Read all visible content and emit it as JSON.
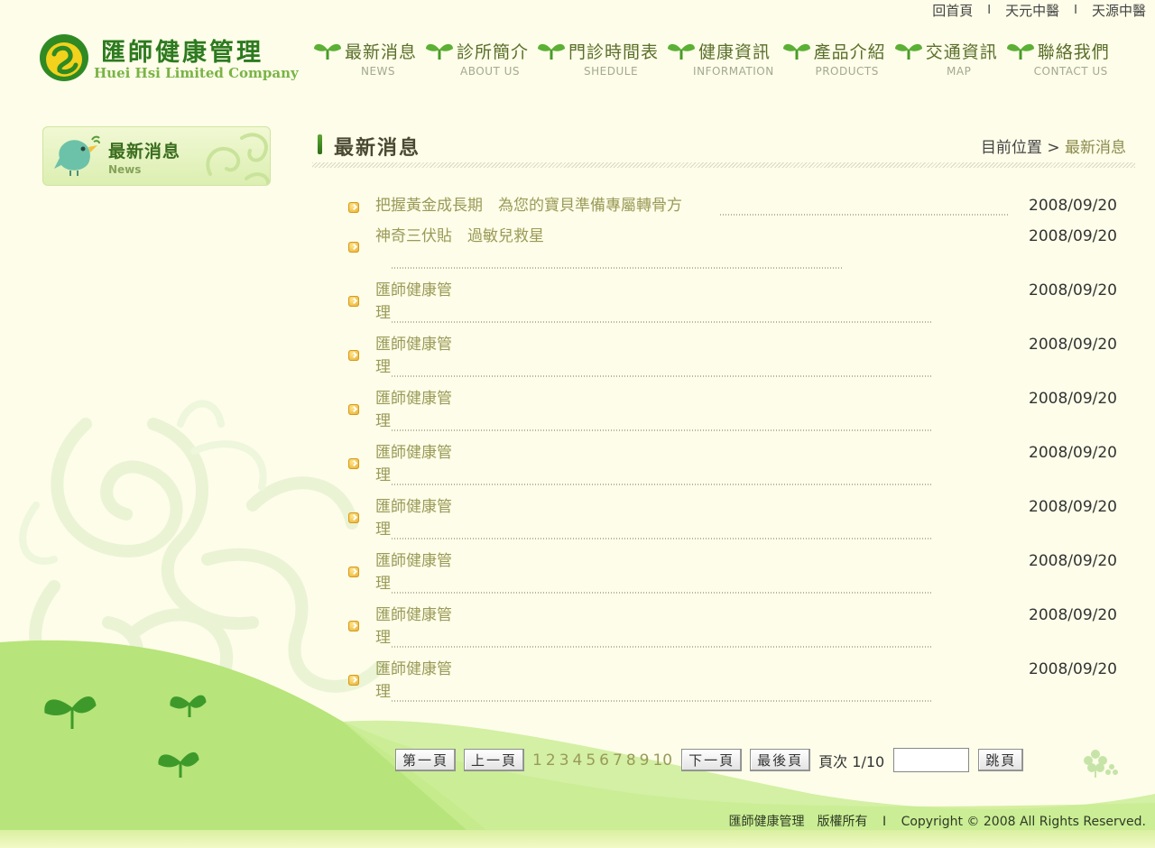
{
  "top_links": [
    {
      "label": "回首頁"
    },
    {
      "label": "天元中醫"
    },
    {
      "label": "天源中醫"
    }
  ],
  "top_separator": "I",
  "logo": {
    "name_cn": "匯師健康管理",
    "name_en": "Huei Hsi Limited Company"
  },
  "nav": [
    {
      "cn": "最新消息",
      "en": "NEWS"
    },
    {
      "cn": "診所簡介",
      "en": "ABOUT US"
    },
    {
      "cn": "門診時間表",
      "en": "SHEDULE"
    },
    {
      "cn": "健康資訊",
      "en": "INFORMATION"
    },
    {
      "cn": "產品介紹",
      "en": "PRODUCTS"
    },
    {
      "cn": "交通資訊",
      "en": "MAP"
    },
    {
      "cn": "聯絡我們",
      "en": "CONTACT US"
    }
  ],
  "side": {
    "title_cn": "最新消息",
    "title_en": "News"
  },
  "content": {
    "title": "最新消息",
    "breadcrumb_prefix": "目前位置",
    "breadcrumb_arrow": ">",
    "breadcrumb_current": "最新消息"
  },
  "news": [
    {
      "title": "把握黃金成長期　為您的寶貝準備專屬轉骨方",
      "date": "2008/09/20"
    },
    {
      "title": "神奇三伏貼　過敏兒救星",
      "date": "2008/09/20"
    },
    {
      "title": "匯師健康管理",
      "date": "2008/09/20"
    },
    {
      "title": "匯師健康管理",
      "date": "2008/09/20"
    },
    {
      "title": "匯師健康管理",
      "date": "2008/09/20"
    },
    {
      "title": "匯師健康管理",
      "date": "2008/09/20"
    },
    {
      "title": "匯師健康管理",
      "date": "2008/09/20"
    },
    {
      "title": "匯師健康管理",
      "date": "2008/09/20"
    },
    {
      "title": "匯師健康管理",
      "date": "2008/09/20"
    },
    {
      "title": "匯師健康管理",
      "date": "2008/09/20"
    }
  ],
  "pager": {
    "first": "第一頁",
    "prev": "上一頁",
    "pages": [
      "1",
      "2",
      "3",
      "4",
      "5",
      "6",
      "7",
      "8",
      "9",
      "10"
    ],
    "next": "下一頁",
    "last": "最後頁",
    "page_label": "頁次",
    "page_value": "1/10",
    "jump_value": "",
    "jump": "跳頁"
  },
  "footer": {
    "owner": "匯師健康管理　版權所有",
    "sep": "I",
    "copyright": "Copyright © 2008 All Rights Reserved."
  },
  "colors": {
    "background": "#fdfde9",
    "brand_green": "#2d7a1f",
    "link_olive": "#9a9a58",
    "hill_green": "#a8dc6a"
  }
}
